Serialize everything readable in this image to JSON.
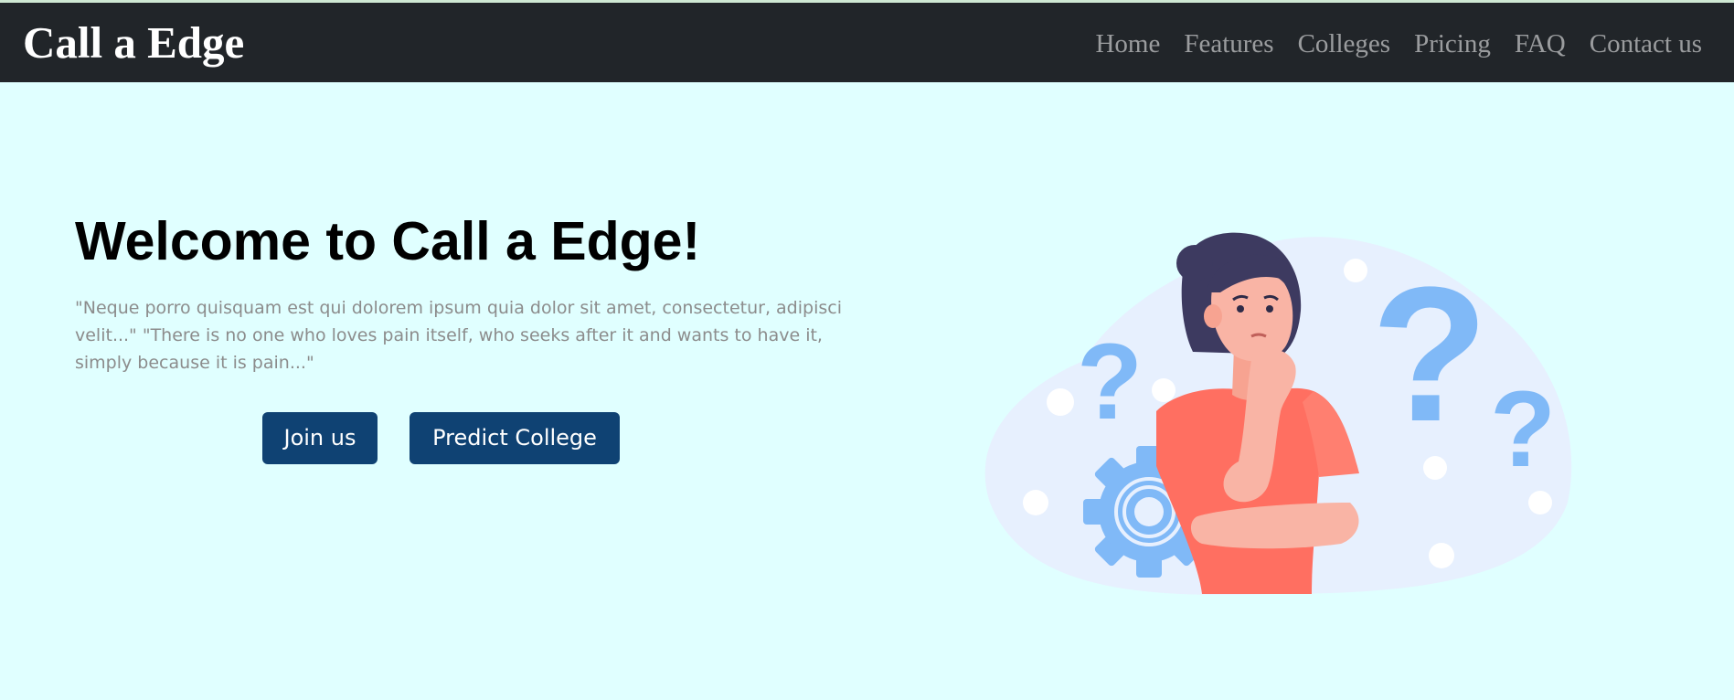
{
  "header": {
    "brand": "Call a Edge",
    "nav": [
      "Home",
      "Features",
      "Colleges",
      "Pricing",
      "FAQ",
      "Contact us"
    ]
  },
  "hero": {
    "title": "Welcome to Call a Edge!",
    "text": "\"Neque porro quisquam est qui dolorem ipsum quia dolor sit amet, consectetur, adipisci velit...\" \"There is no one who loves pain itself, who seeks after it and wants to have it, simply because it is pain...\"",
    "buttons": {
      "join": "Join us",
      "predict": "Predict College"
    },
    "illustration_icon": "thinking-woman-illustration"
  },
  "colors": {
    "page_background": "#e0ffff",
    "navbar_background": "#212529",
    "button_background": "#0f4273",
    "accent_blue": "#80b9f7",
    "shirt": "#ff6f61"
  }
}
